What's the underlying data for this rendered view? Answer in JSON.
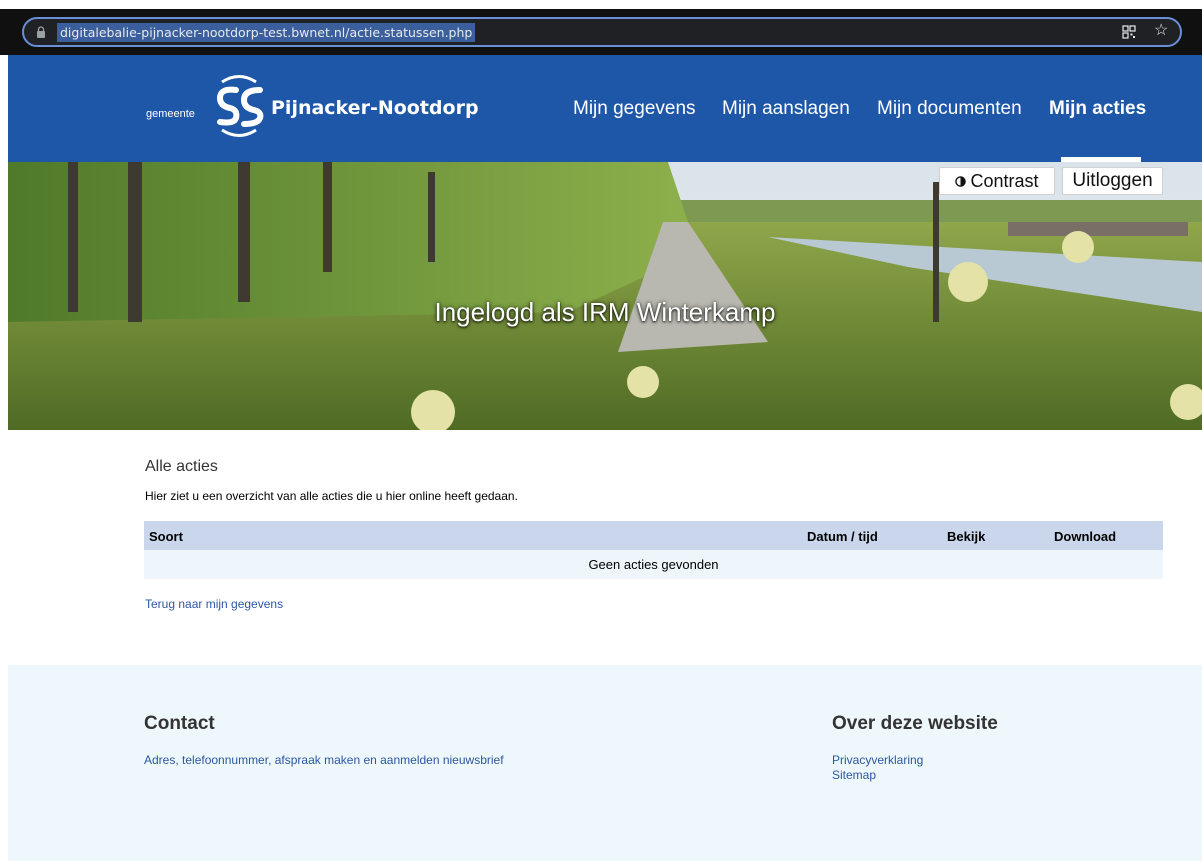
{
  "browser": {
    "url": "digitalebalie-pijnacker-nootdorp-test.bwnet.nl/actie.statussen.php",
    "icons": [
      "lock-icon",
      "qr-code-icon",
      "star-icon"
    ]
  },
  "header": {
    "logo_prefix": "gemeente",
    "logo_name": "Pijnacker-Nootdorp",
    "nav": [
      {
        "label": "Mijn gegevens",
        "active": false
      },
      {
        "label": "Mijn aanslagen",
        "active": false
      },
      {
        "label": "Mijn documenten",
        "active": false
      },
      {
        "label": "Mijn acties",
        "active": true
      }
    ],
    "brand_color": "#1e57a8"
  },
  "hero": {
    "title": "Ingelogd als IRM Winterkamp",
    "contrast_label": "Contrast",
    "logout_label": "Uitloggen"
  },
  "main": {
    "title": "Alle acties",
    "description": "Hier ziet u een overzicht van alle acties die u hier online heeft gedaan.",
    "table": {
      "columns": [
        "Soort",
        "Datum / tijd",
        "Bekijk",
        "Download"
      ],
      "empty_message": "Geen acties gevonden"
    },
    "back_link": "Terug naar mijn gegevens"
  },
  "footer": {
    "contact": {
      "heading": "Contact",
      "links": [
        "Adres, telefoonnummer, afspraak maken en aanmelden nieuwsbrief"
      ]
    },
    "about": {
      "heading": "Over deze website",
      "links": [
        "Privacyverklaring",
        "Sitemap"
      ]
    }
  },
  "colors": {
    "link": "#2c57a2",
    "table_header": "#c9d6ec",
    "table_row": "#eef6fb",
    "footer_bg": "#eef7fb"
  }
}
